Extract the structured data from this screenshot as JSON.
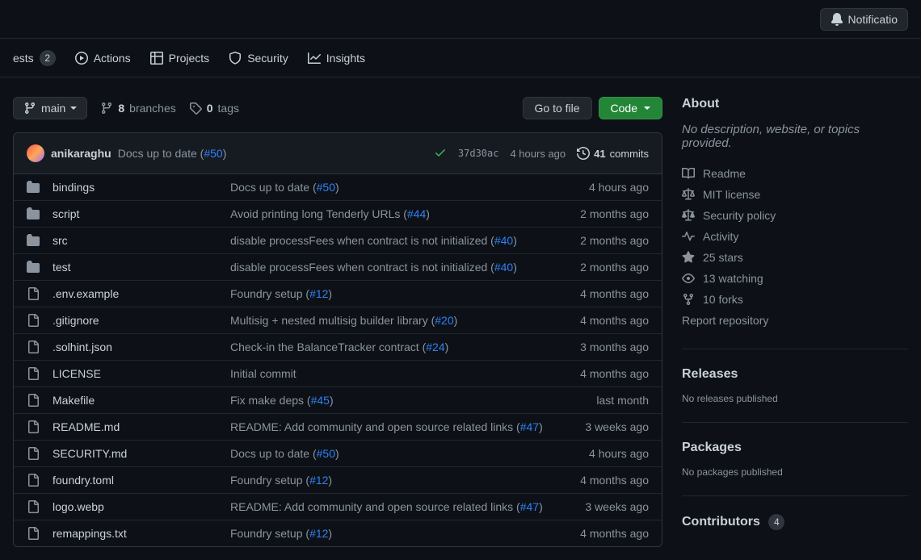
{
  "header": {
    "notifications": "Notificatio"
  },
  "tabs": {
    "pull_requests_suffix": "ests",
    "pull_requests_count": "2",
    "actions": "Actions",
    "projects": "Projects",
    "security": "Security",
    "insights": "Insights"
  },
  "toolbar": {
    "branch": "main",
    "branches_count": "8",
    "branches_label": "branches",
    "tags_count": "0",
    "tags_label": "tags",
    "goto_file": "Go to file",
    "code": "Code"
  },
  "commit_header": {
    "author": "anikaraghu",
    "message": "Docs up to date (",
    "pr": "#50",
    "msg_close": ")",
    "sha": "37d30ac",
    "time": "4 hours ago",
    "commits_count": "41",
    "commits_label": "commits"
  },
  "files": [
    {
      "type": "dir",
      "name": "bindings",
      "msg": "Docs up to date (",
      "pr": "#50",
      "msg2": ")",
      "time": "4 hours ago"
    },
    {
      "type": "dir",
      "name": "script",
      "msg": "Avoid printing long Tenderly URLs (",
      "pr": "#44",
      "msg2": ")",
      "time": "2 months ago"
    },
    {
      "type": "dir",
      "name": "src",
      "msg": "disable processFees when contract is not initialized (",
      "pr": "#40",
      "msg2": ")",
      "time": "2 months ago"
    },
    {
      "type": "dir",
      "name": "test",
      "msg": "disable processFees when contract is not initialized (",
      "pr": "#40",
      "msg2": ")",
      "time": "2 months ago"
    },
    {
      "type": "file",
      "name": ".env.example",
      "msg": "Foundry setup (",
      "pr": "#12",
      "msg2": ")",
      "time": "4 months ago"
    },
    {
      "type": "file",
      "name": ".gitignore",
      "msg": "Multisig + nested multisig builder library (",
      "pr": "#20",
      "msg2": ")",
      "time": "4 months ago"
    },
    {
      "type": "file",
      "name": ".solhint.json",
      "msg": "Check-in the BalanceTracker contract (",
      "pr": "#24",
      "msg2": ")",
      "time": "3 months ago"
    },
    {
      "type": "file",
      "name": "LICENSE",
      "msg": "Initial commit",
      "pr": "",
      "msg2": "",
      "time": "4 months ago"
    },
    {
      "type": "file",
      "name": "Makefile",
      "msg": "Fix make deps (",
      "pr": "#45",
      "msg2": ")",
      "time": "last month"
    },
    {
      "type": "file",
      "name": "README.md",
      "msg": "README: Add community and open source related links (",
      "pr": "#47",
      "msg2": ")",
      "time": "3 weeks ago"
    },
    {
      "type": "file",
      "name": "SECURITY.md",
      "msg": "Docs up to date (",
      "pr": "#50",
      "msg2": ")",
      "time": "4 hours ago"
    },
    {
      "type": "file",
      "name": "foundry.toml",
      "msg": "Foundry setup (",
      "pr": "#12",
      "msg2": ")",
      "time": "4 months ago"
    },
    {
      "type": "file",
      "name": "logo.webp",
      "msg": "README: Add community and open source related links (",
      "pr": "#47",
      "msg2": ")",
      "time": "3 weeks ago"
    },
    {
      "type": "file",
      "name": "remappings.txt",
      "msg": "Foundry setup (",
      "pr": "#12",
      "msg2": ")",
      "time": "4 months ago"
    }
  ],
  "about": {
    "title": "About",
    "description": "No description, website, or topics provided.",
    "readme": "Readme",
    "license": "MIT license",
    "security": "Security policy",
    "activity": "Activity",
    "stars": "25 stars",
    "watching": "13 watching",
    "forks": "10 forks",
    "report": "Report repository"
  },
  "releases": {
    "title": "Releases",
    "sub": "No releases published"
  },
  "packages": {
    "title": "Packages",
    "sub": "No packages published"
  },
  "contributors": {
    "title": "Contributors",
    "count": "4"
  }
}
